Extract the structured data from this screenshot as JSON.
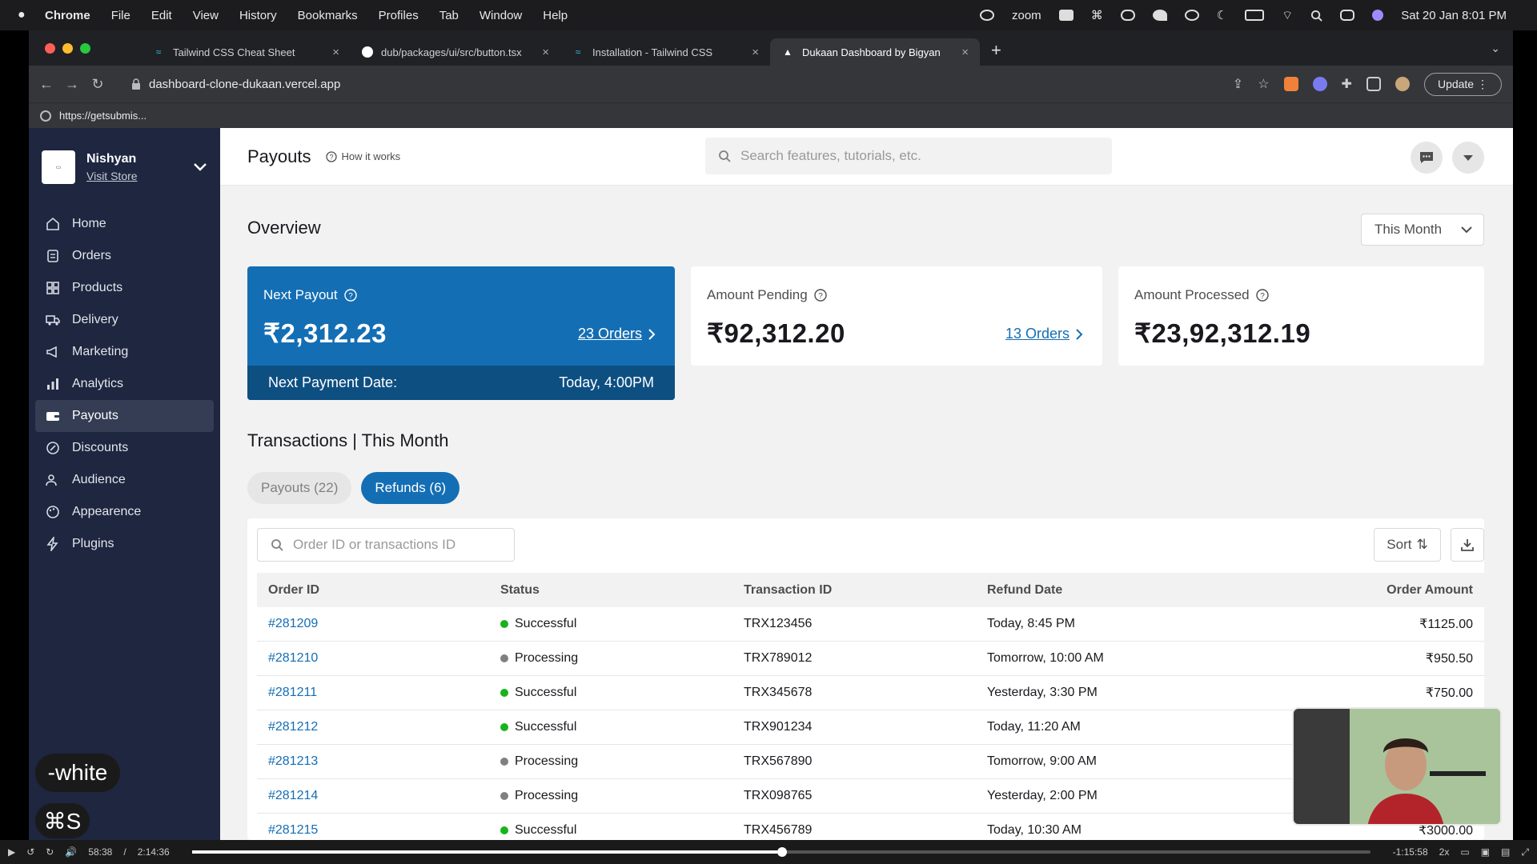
{
  "menubar": {
    "app": "Chrome",
    "items": [
      "File",
      "Edit",
      "View",
      "History",
      "Bookmarks",
      "Profiles",
      "Tab",
      "Window",
      "Help"
    ],
    "zoom_label": "zoom",
    "clock": "Sat 20 Jan  8:01 PM"
  },
  "browser": {
    "tabs": [
      {
        "label": "Tailwind CSS Cheat Sheet",
        "icon": "tailwind-icon"
      },
      {
        "label": "dub/packages/ui/src/button.tsx",
        "icon": "github-icon"
      },
      {
        "label": "Installation - Tailwind CSS",
        "icon": "tailwind-icon"
      },
      {
        "label": "Dukaan Dashboard by Bigyan",
        "icon": "vercel-icon"
      }
    ],
    "url": "dashboard-clone-dukaan.vercel.app",
    "update_label": "Update",
    "bookmark": "https://getsubmis..."
  },
  "sidebar": {
    "store_name": "Nishyan",
    "visit_store": "Visit Store",
    "items": [
      {
        "label": "Home",
        "icon": "home-icon"
      },
      {
        "label": "Orders",
        "icon": "orders-icon"
      },
      {
        "label": "Products",
        "icon": "products-icon"
      },
      {
        "label": "Delivery",
        "icon": "truck-icon"
      },
      {
        "label": "Marketing",
        "icon": "megaphone-icon"
      },
      {
        "label": "Analytics",
        "icon": "chart-icon"
      },
      {
        "label": "Payouts",
        "icon": "wallet-icon"
      },
      {
        "label": "Discounts",
        "icon": "discount-icon"
      },
      {
        "label": "Audience",
        "icon": "people-icon"
      },
      {
        "label": "Appearence",
        "icon": "palette-icon"
      },
      {
        "label": "Plugins",
        "icon": "bolt-icon"
      }
    ],
    "active": "Payouts"
  },
  "header": {
    "title": "Payouts",
    "how_it_works": "How it works",
    "search_placeholder": "Search features, tutorials, etc."
  },
  "overview": {
    "title": "Overview",
    "period": "This Month",
    "next_payout": {
      "label": "Next Payout",
      "value": "₹2,312.23",
      "link": "23 Orders",
      "footer_label": "Next Payment Date:",
      "footer_value": "Today, 4:00PM"
    },
    "pending": {
      "label": "Amount Pending",
      "value": "₹92,312.20",
      "link": "13 Orders"
    },
    "processed": {
      "label": "Amount Processed",
      "value": "₹23,92,312.19"
    }
  },
  "transactions": {
    "title": "Transactions | This Month",
    "tabs": [
      {
        "label": "Payouts (22)"
      },
      {
        "label": "Refunds (6)"
      }
    ],
    "search_placeholder": "Order ID or transactions ID",
    "sort_label": "Sort",
    "columns": [
      "Order ID",
      "Status",
      "Transaction ID",
      "Refund Date",
      "Order Amount"
    ],
    "rows": [
      {
        "order": "#281209",
        "status": "Successful",
        "txn": "TRX123456",
        "date": "Today, 8:45 PM",
        "amount": "₹1125.00"
      },
      {
        "order": "#281210",
        "status": "Processing",
        "txn": "TRX789012",
        "date": "Tomorrow, 10:00 AM",
        "amount": "₹950.50"
      },
      {
        "order": "#281211",
        "status": "Successful",
        "txn": "TRX345678",
        "date": "Yesterday, 3:30 PM",
        "amount": "₹750.00"
      },
      {
        "order": "#281212",
        "status": "Successful",
        "txn": "TRX901234",
        "date": "Today, 11:20 AM",
        "amount": ""
      },
      {
        "order": "#281213",
        "status": "Processing",
        "txn": "TRX567890",
        "date": "Tomorrow, 9:00 AM",
        "amount": ""
      },
      {
        "order": "#281214",
        "status": "Processing",
        "txn": "TRX098765",
        "date": "Yesterday, 2:00 PM",
        "amount": ""
      },
      {
        "order": "#281215",
        "status": "Successful",
        "txn": "TRX456789",
        "date": "Today, 10:30 AM",
        "amount": "₹3000.00"
      }
    ]
  },
  "colors": {
    "success": "#17b31b",
    "processing": "#808080",
    "brand": "#146eb4"
  },
  "overlay": {
    "shortcut_word": "-white",
    "shortcut_keys": "⌘S"
  },
  "player": {
    "elapsed": "58:38",
    "total": "2:14:36",
    "remaining": "-1:15:58",
    "speed": "2x",
    "progress_percent": 49.7
  }
}
